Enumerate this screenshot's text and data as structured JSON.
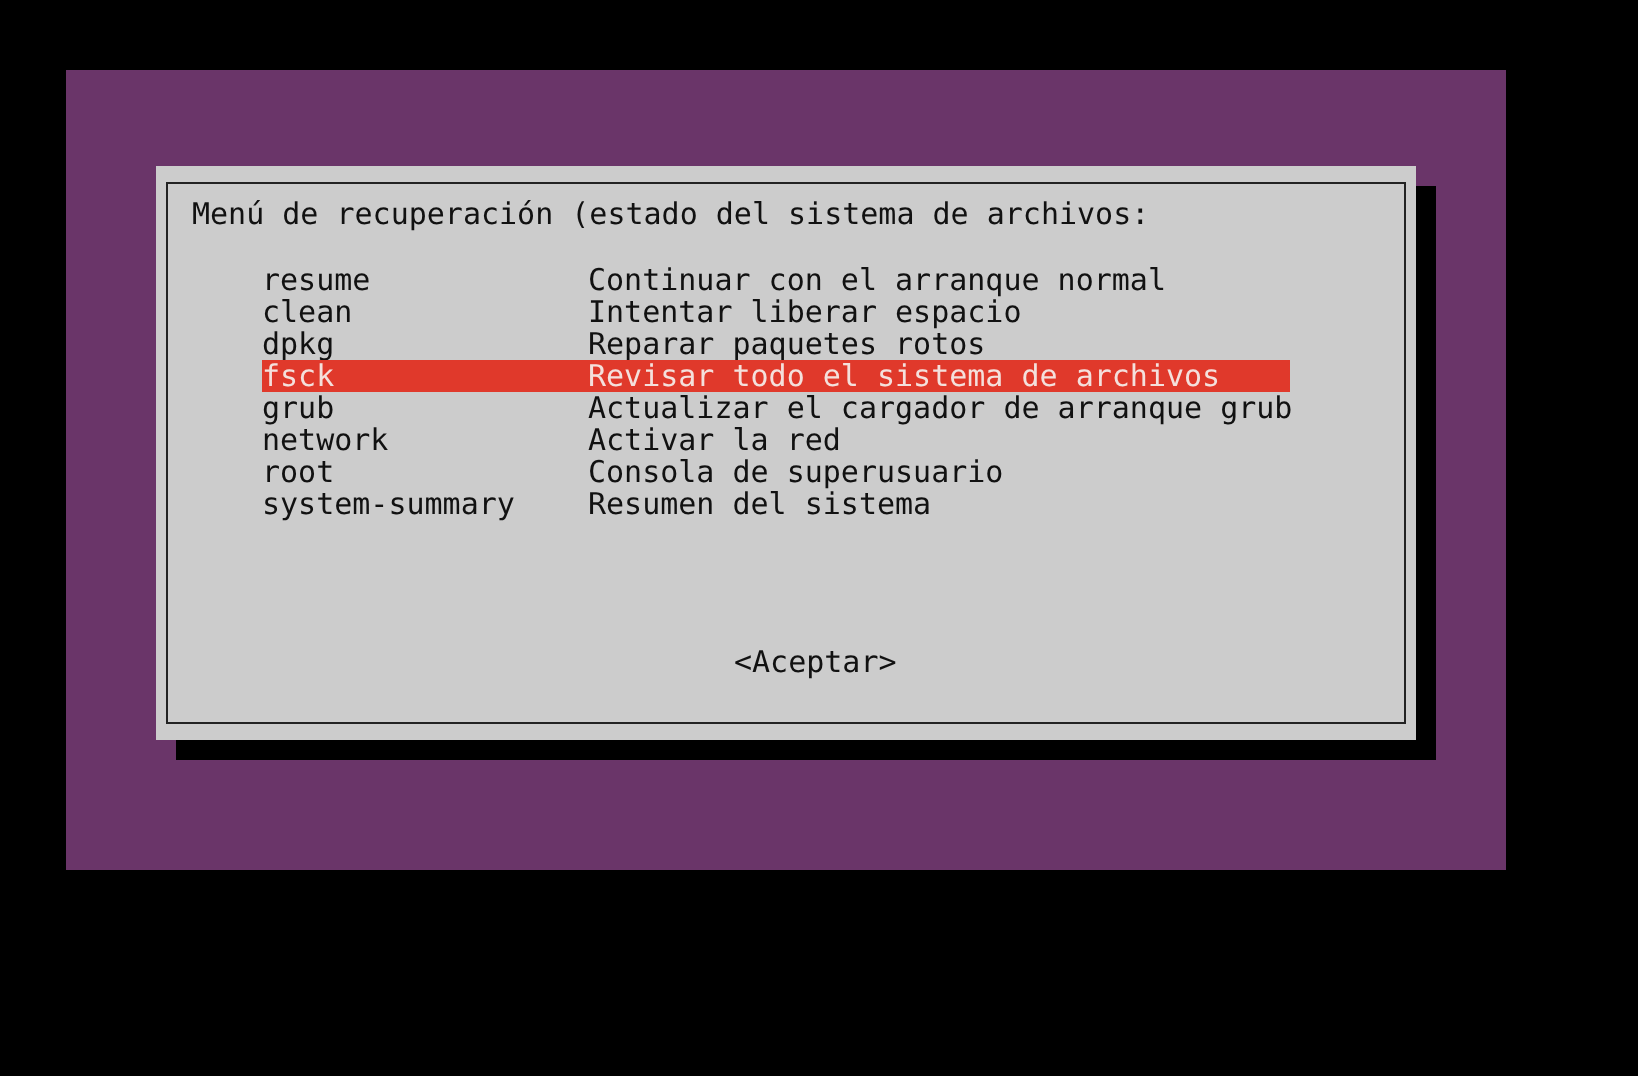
{
  "dialog": {
    "title": "Menú de recuperación (estado del sistema de archivos:",
    "items": [
      {
        "name": "resume",
        "description": "Continuar con el arranque normal",
        "selected": false
      },
      {
        "name": "clean",
        "description": "Intentar liberar espacio",
        "selected": false
      },
      {
        "name": "dpkg",
        "description": "Reparar paquetes rotos",
        "selected": false
      },
      {
        "name": "fsck",
        "description": "Revisar todo el sistema de archivos",
        "selected": true
      },
      {
        "name": "grub",
        "description": "Actualizar el cargador de arranque grub",
        "selected": false
      },
      {
        "name": "network",
        "description": "Activar la red",
        "selected": false
      },
      {
        "name": "root",
        "description": "Consola de superusuario",
        "selected": false
      },
      {
        "name": "system-summary",
        "description": "Resumen del sistema",
        "selected": false
      }
    ],
    "button": "<Aceptar>"
  }
}
